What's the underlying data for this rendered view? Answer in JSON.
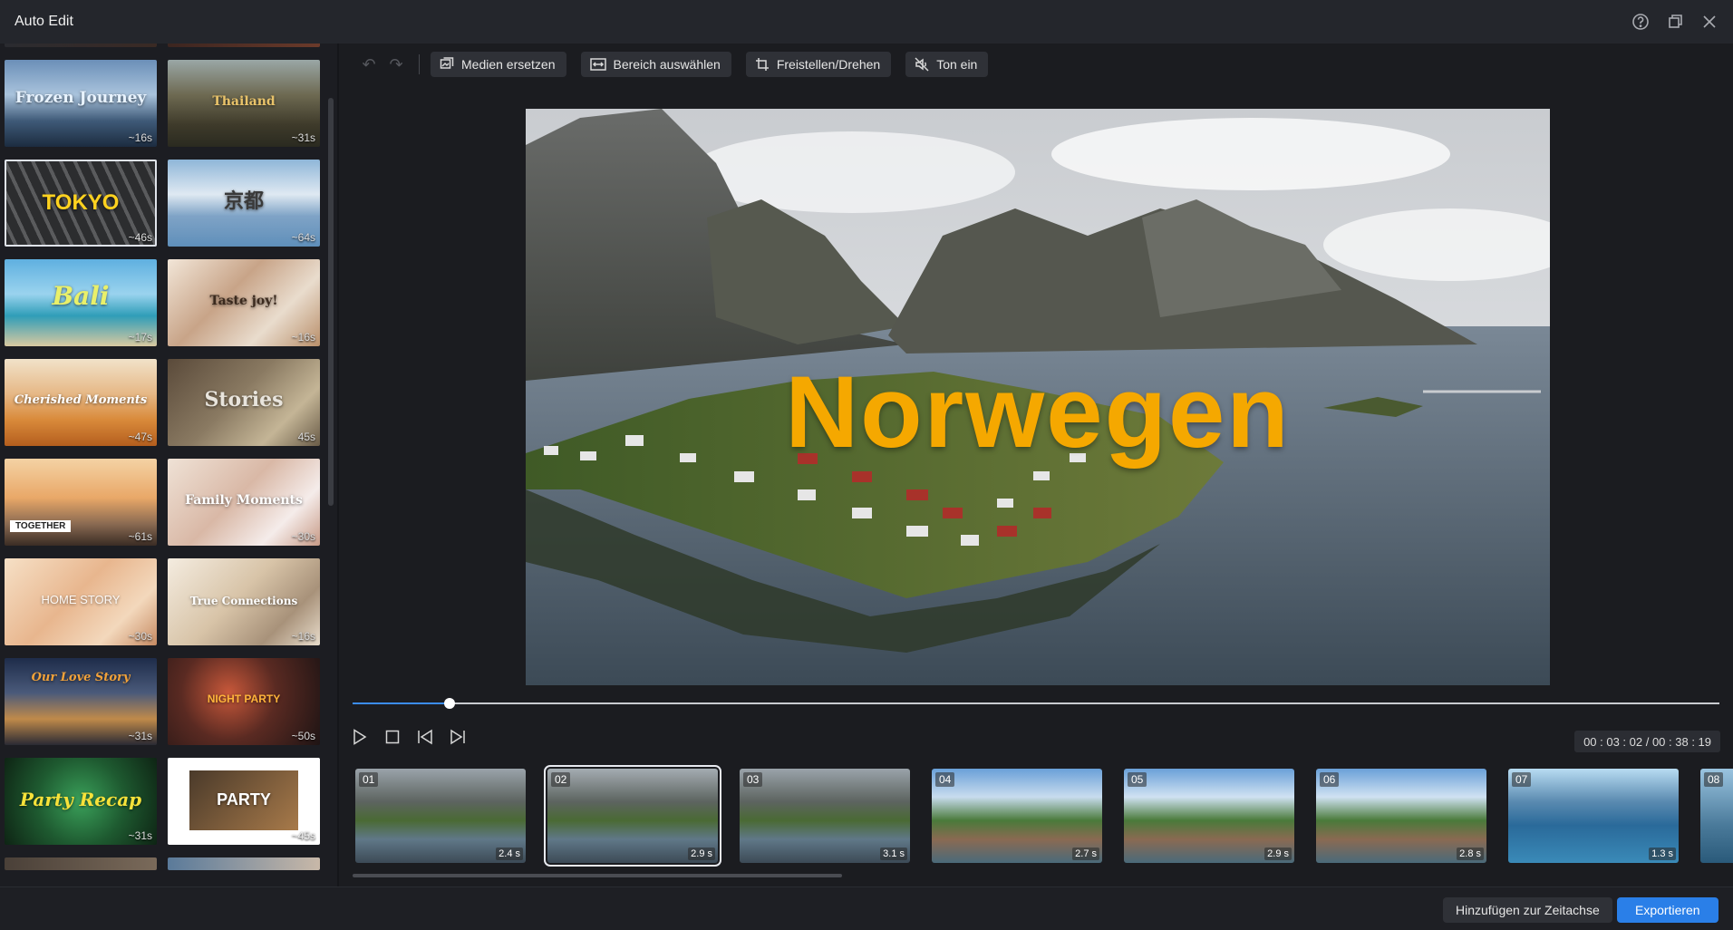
{
  "window": {
    "title": "Auto Edit",
    "controls": [
      "help-icon",
      "restore-icon",
      "close-icon"
    ]
  },
  "toolbar": {
    "undo_icon": "undo-icon",
    "redo_icon": "redo-icon",
    "buttons": [
      {
        "label": "Medien ersetzen",
        "icon": "replace-media-icon"
      },
      {
        "label": "Bereich auswählen",
        "icon": "select-range-icon"
      },
      {
        "label": "Freistellen/Drehen",
        "icon": "crop-rotate-icon"
      },
      {
        "label": "Ton ein",
        "icon": "speaker-muted-icon"
      }
    ]
  },
  "templates": [
    {
      "title": "Frozen Journey",
      "duration": "~16s"
    },
    {
      "title": "Thailand",
      "duration": "~31s"
    },
    {
      "title": "TOKYO",
      "duration": "~46s",
      "selected": true
    },
    {
      "title": "京都",
      "duration": "~64s"
    },
    {
      "title": "Bali",
      "duration": "~17s"
    },
    {
      "title": "Taste joy!",
      "duration": "~16s"
    },
    {
      "title": "Cherished Moments",
      "duration": "~47s"
    },
    {
      "title": "Stories",
      "duration": "45s"
    },
    {
      "title": "TOGETHER",
      "duration": "~61s"
    },
    {
      "title": "Family Moments",
      "duration": "~30s"
    },
    {
      "title": "HOME STORY",
      "duration": "~30s"
    },
    {
      "title": "True Connections",
      "duration": "~16s"
    },
    {
      "title": "Our Love Story",
      "duration": "~31s"
    },
    {
      "title": "NIGHT PARTY",
      "duration": "~50s"
    },
    {
      "title": "Party Recap",
      "duration": "~31s"
    },
    {
      "title": "PARTY",
      "duration": "~45s"
    }
  ],
  "preview": {
    "title": "Norwegen",
    "title_color": "#f5a800"
  },
  "playback": {
    "progress_fraction": 0.071,
    "timecode": "00 : 03 : 02 / 00 : 38 : 19",
    "controls": [
      "play-icon",
      "stop-icon",
      "previous-frame-icon",
      "next-frame-icon"
    ]
  },
  "clips": [
    {
      "num": "01",
      "duration": "2.4 s"
    },
    {
      "num": "02",
      "duration": "2.9 s",
      "selected": true
    },
    {
      "num": "03",
      "duration": "3.1 s"
    },
    {
      "num": "04",
      "duration": "2.7 s"
    },
    {
      "num": "05",
      "duration": "2.9 s"
    },
    {
      "num": "06",
      "duration": "2.8 s"
    },
    {
      "num": "07",
      "duration": "1.3 s"
    },
    {
      "num": "08",
      "duration": ""
    }
  ],
  "footer": {
    "add_label": "Hinzufügen zur Zeitachse",
    "export_label": "Exportieren"
  },
  "colors": {
    "accent": "#2a7fe8",
    "background": "#1b1c20",
    "titlebar": "#24262c"
  }
}
